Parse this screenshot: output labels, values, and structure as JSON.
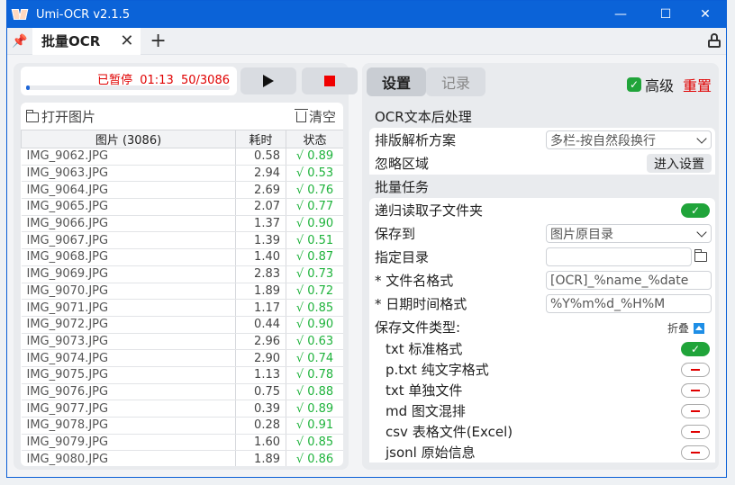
{
  "window": {
    "title": "Umi-OCR v2.1.5"
  },
  "tabbar": {
    "tab_label": "批量OCR",
    "close_glyph": "✕",
    "add_glyph": "+"
  },
  "status": {
    "state": "已暂停",
    "elapsed": "01:13",
    "progress_text": "50/3086",
    "progress_fraction": 0.016
  },
  "filelist": {
    "open_label": "打开图片",
    "clear_label": "清空",
    "columns": [
      "图片 (3086)",
      "耗时",
      "状态"
    ],
    "rows": [
      [
        "IMG_9062.JPG",
        "0.58",
        "√ 0.89"
      ],
      [
        "IMG_9063.JPG",
        "2.94",
        "√ 0.53"
      ],
      [
        "IMG_9064.JPG",
        "2.69",
        "√ 0.76"
      ],
      [
        "IMG_9065.JPG",
        "2.07",
        "√ 0.77"
      ],
      [
        "IMG_9066.JPG",
        "1.37",
        "√ 0.90"
      ],
      [
        "IMG_9067.JPG",
        "1.39",
        "√ 0.51"
      ],
      [
        "IMG_9068.JPG",
        "1.40",
        "√ 0.87"
      ],
      [
        "IMG_9069.JPG",
        "2.83",
        "√ 0.73"
      ],
      [
        "IMG_9070.JPG",
        "1.89",
        "√ 0.72"
      ],
      [
        "IMG_9071.JPG",
        "1.17",
        "√ 0.85"
      ],
      [
        "IMG_9072.JPG",
        "0.44",
        "√ 0.90"
      ],
      [
        "IMG_9073.JPG",
        "2.96",
        "√ 0.63"
      ],
      [
        "IMG_9074.JPG",
        "2.90",
        "√ 0.74"
      ],
      [
        "IMG_9075.JPG",
        "1.13",
        "√ 0.78"
      ],
      [
        "IMG_9076.JPG",
        "0.75",
        "√ 0.88"
      ],
      [
        "IMG_9077.JPG",
        "0.39",
        "√ 0.89"
      ],
      [
        "IMG_9078.JPG",
        "0.28",
        "√ 0.91"
      ],
      [
        "IMG_9079.JPG",
        "1.60",
        "√ 0.85"
      ],
      [
        "IMG_9080.JPG",
        "1.89",
        "√ 0.86"
      ]
    ]
  },
  "settings_panel": {
    "tab_settings": "设置",
    "tab_records": "记录",
    "advanced_label": "高级",
    "reset_label": "重置",
    "sec_post": "OCR文本后处理",
    "layout_label": "排版解析方案",
    "layout_value": "多栏-按自然段换行",
    "ignore_label": "忽略区域",
    "ignore_button": "进入设置",
    "sec_batch": "批量任务",
    "recursive_label": "递归读取子文件夹",
    "save_to_label": "保存到",
    "save_to_value": "图片原目录",
    "dir_label": "指定目录",
    "dir_value": "",
    "fname_label": "* 文件名格式",
    "fname_value": "[OCR]_%name_%date",
    "datefmt_label": "* 日期时间格式",
    "datefmt_value": "%Y%m%d_%H%M",
    "filetypes_label": "保存文件类型:",
    "fold_label": "折叠",
    "types": [
      {
        "label": "txt 标准格式",
        "on": true
      },
      {
        "label": "p.txt 纯文字格式",
        "on": false
      },
      {
        "label": "txt 单独文件",
        "on": false
      },
      {
        "label": "md 图文混排",
        "on": false
      },
      {
        "label": "csv 表格文件(Excel)",
        "on": false
      },
      {
        "label": "jsonl 原始信息",
        "on": false
      }
    ]
  },
  "colors": {
    "accent": "#0b63d8",
    "error": "#e00000",
    "success": "#20a43a"
  }
}
